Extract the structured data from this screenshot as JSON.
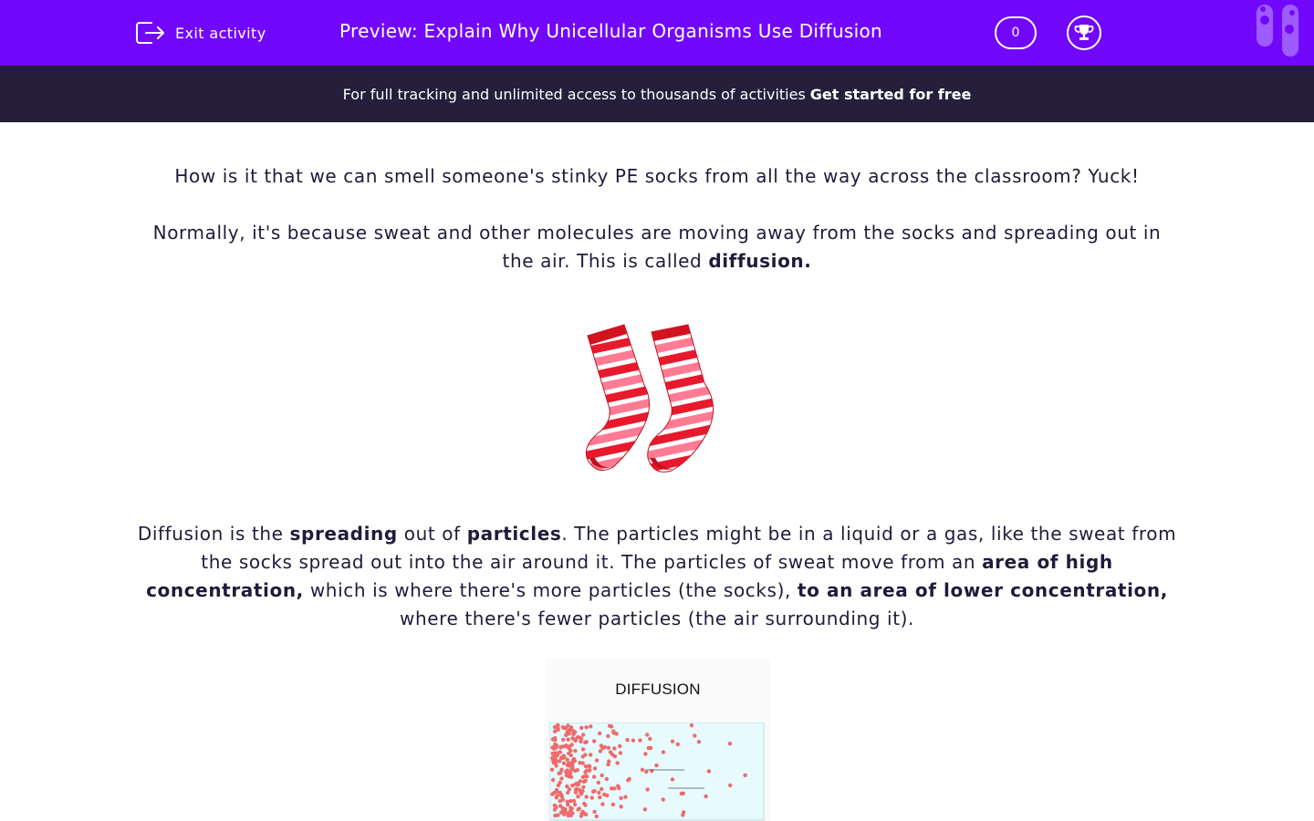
{
  "header": {
    "exit_label": "Exit activity",
    "title": "Preview: Explain Why Unicellular Organisms Use Diffusion",
    "score": "0",
    "background_color": "#7208fb"
  },
  "banner": {
    "text": "For full tracking and unlimited access to thousands of activities",
    "cta": "Get started for free",
    "background_color": "#251f3c"
  },
  "content": {
    "p1": "How is it that we can smell someone's stinky PE socks from all the way across the classroom? Yuck!",
    "p2_start": "Normally, it's because sweat and other molecules are moving away from the socks and spreading out in the air. This is called ",
    "p2_bold": "diffusion.",
    "p3": {
      "t1": "Diffusion is the ",
      "b1": "spreading",
      "t2": " out of ",
      "b2": "particles",
      "t3": ". The particles might be in a liquid or a gas, like the sweat from the socks spread out into the air around it. The particles of sweat move from an ",
      "b3": "area of high concentration,",
      "t4": " which is where there's more particles (the socks), ",
      "b4": "to an area of lower concentration,",
      "t5": " where there's fewer particles (the air surrounding it)."
    },
    "socks_icon": "striped-socks",
    "diagram_title": "DIFFUSION"
  }
}
